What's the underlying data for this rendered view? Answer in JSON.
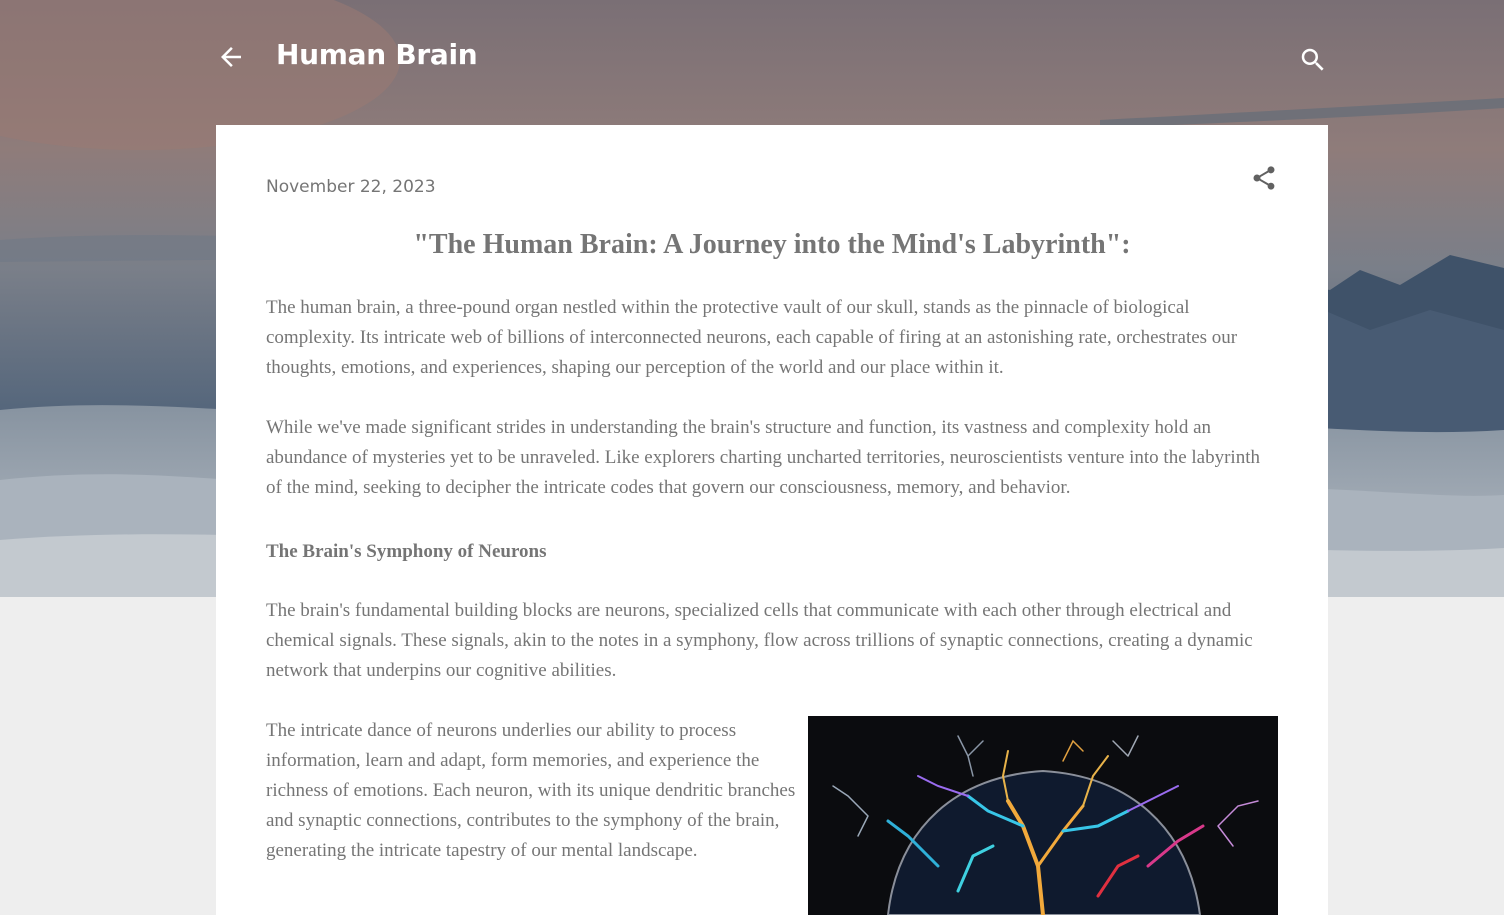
{
  "header": {
    "blog_title": "Human Brain",
    "back_icon": "arrow-left-icon",
    "search_icon": "search-icon"
  },
  "post": {
    "date": "November 22, 2023",
    "share_icon": "share-icon",
    "title": "\"The Human Brain: A Journey into the Mind's Labyrinth\":",
    "paragraphs": [
      "The human brain, a three-pound organ nestled within the protective vault of our skull, stands as the pinnacle of biological complexity. Its intricate web of billions of interconnected neurons, each capable of firing at an astonishing rate, orchestrates our thoughts, emotions, and experiences, shaping our perception of the world and our place within it.",
      "While we've made significant strides in understanding the brain's structure and function, its vastness and complexity hold an abundance of mysteries yet to be unraveled. Like explorers charting uncharted territories, neuroscientists venture into the labyrinth of the mind, seeking to decipher the intricate codes that govern our consciousness, memory, and behavior.",
      "The brain's fundamental building blocks are neurons, specialized cells that communicate with each other through electrical and chemical signals. These signals, akin to the notes in a symphony, flow across trillions of synaptic connections, creating a dynamic network that underpins our cognitive abilities.",
      "The intricate dance of neurons underlies our ability to process information, learn and adapt, form memories, and experience the richness of emotions. Each neuron, with its unique dendritic branches and synaptic connections, contributes to the symphony of the brain, generating the intricate tapestry of our mental landscape."
    ],
    "subheading": "The Brain's Symphony of Neurons",
    "image_subject": "colorful-neuron-brain-illustration"
  },
  "colors": {
    "text_gray": "#757575",
    "card_bg": "#ffffff",
    "page_bg": "#eeeeee"
  }
}
